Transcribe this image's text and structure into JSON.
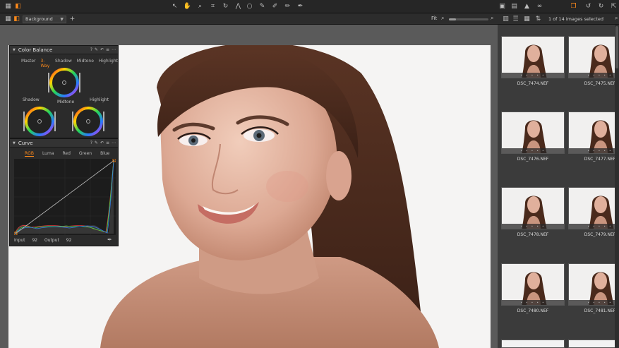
{
  "toolbar": {
    "icons": [
      "select-icon",
      "pan-icon",
      "loupe-icon",
      "crop-icon",
      "rotate-icon",
      "keystone-icon",
      "spot-icon",
      "brush-icon",
      "erase-icon",
      "gradient-icon",
      "picker-icon"
    ],
    "right_icons": [
      "camera-icon",
      "grid-icon",
      "warning-icon",
      "glasses-icon",
      "variant-icon",
      "undo-icon",
      "redo-icon",
      "cursor-icon"
    ]
  },
  "viewer": {
    "layer_select": "Background",
    "fit_label": "Fit"
  },
  "browser": {
    "selection_status": "1 of 14 images selected"
  },
  "color_balance": {
    "title": "Color Balance",
    "tabs": [
      "Master",
      "3-Way",
      "Shadow",
      "Midtone",
      "Highlight"
    ],
    "active_tab": "3-Way",
    "labels": {
      "midtone": "Midtone",
      "shadow": "Shadow",
      "highlight": "Highlight"
    }
  },
  "curve": {
    "title": "Curve",
    "tabs": [
      "RGB",
      "Luma",
      "Red",
      "Green",
      "Blue"
    ],
    "active_tab": "RGB",
    "input_label": "Input",
    "input_value": "92",
    "output_label": "Output",
    "output_value": "92"
  },
  "thumbnails": [
    {
      "name": "DSC_7474.NEF"
    },
    {
      "name": "DSC_7475.NEF"
    },
    {
      "name": "DSC_7476.NEF"
    },
    {
      "name": "DSC_7477.NEF"
    },
    {
      "name": "DSC_7478.NEF"
    },
    {
      "name": "DSC_7479.NEF"
    },
    {
      "name": "DSC_7480.NEF"
    },
    {
      "name": "DSC_7481.NEF"
    }
  ],
  "colors": {
    "accent": "#ff8a1a",
    "panel": "#2b2b2b",
    "viewer_bg": "#5a5a5a"
  }
}
